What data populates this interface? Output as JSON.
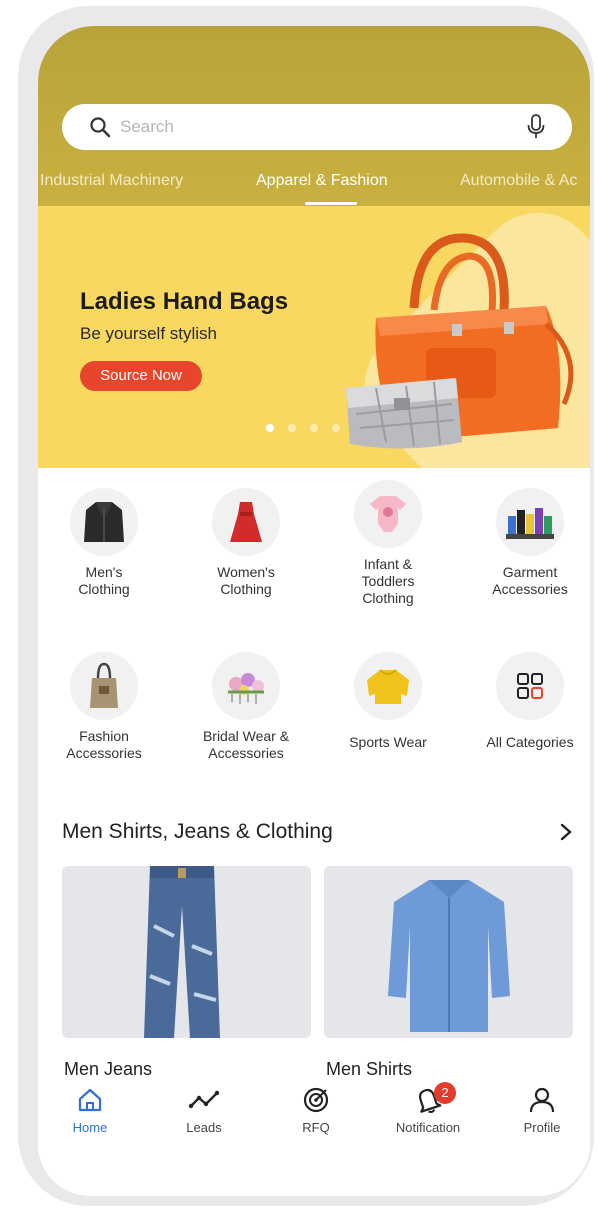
{
  "search": {
    "placeholder": "Search",
    "value": ""
  },
  "category_tabs": [
    {
      "label": "Industrial Machinery"
    },
    {
      "label": "Apparel & Fashion"
    },
    {
      "label": "Automobile & Ac"
    }
  ],
  "active_tab": "Apparel & Fashion",
  "banner": {
    "title": "Ladies Hand Bags",
    "subtitle": "Be yourself stylish",
    "button_label": "Source Now",
    "slide_count": 4,
    "active_slide": 1
  },
  "categories": [
    {
      "label": "Men's\nClothing",
      "icon": "leather-jacket-icon"
    },
    {
      "label": "Women's\nClothing",
      "icon": "red-dress-icon"
    },
    {
      "label": "Infant &\nToddlers\nClothing",
      "icon": "baby-onesie-icon"
    },
    {
      "label": "Garment\nAccessories",
      "icon": "shoes-collection-icon"
    },
    {
      "label": "Fashion\nAccessories",
      "icon": "tote-bag-icon"
    },
    {
      "label": "Bridal Wear &\nAccessories",
      "icon": "floral-hair-clip-icon"
    },
    {
      "label": "Sports Wear",
      "icon": "yellow-sweatshirt-icon"
    },
    {
      "label": "All Categories",
      "icon": "grid-icon"
    }
  ],
  "section": {
    "title": "Men Shirts, Jeans & Clothing",
    "products": [
      {
        "label": "Men Jeans",
        "icon": "jeans-icon"
      },
      {
        "label": "Men Shirts",
        "icon": "shirt-icon"
      }
    ]
  },
  "bottom_nav": [
    {
      "label": "Home",
      "icon": "home-icon",
      "active": true
    },
    {
      "label": "Leads",
      "icon": "trend-line-icon"
    },
    {
      "label": "RFQ",
      "icon": "target-icon"
    },
    {
      "label": "Notification",
      "icon": "bell-icon",
      "badge": "2"
    },
    {
      "label": "Profile",
      "icon": "person-icon"
    }
  ],
  "colors": {
    "header": "#c2ab3d",
    "banner_bg": "#f9d862",
    "cta": "#e8452d",
    "nav_active": "#2f6fd6",
    "badge": "#e33c2c"
  }
}
